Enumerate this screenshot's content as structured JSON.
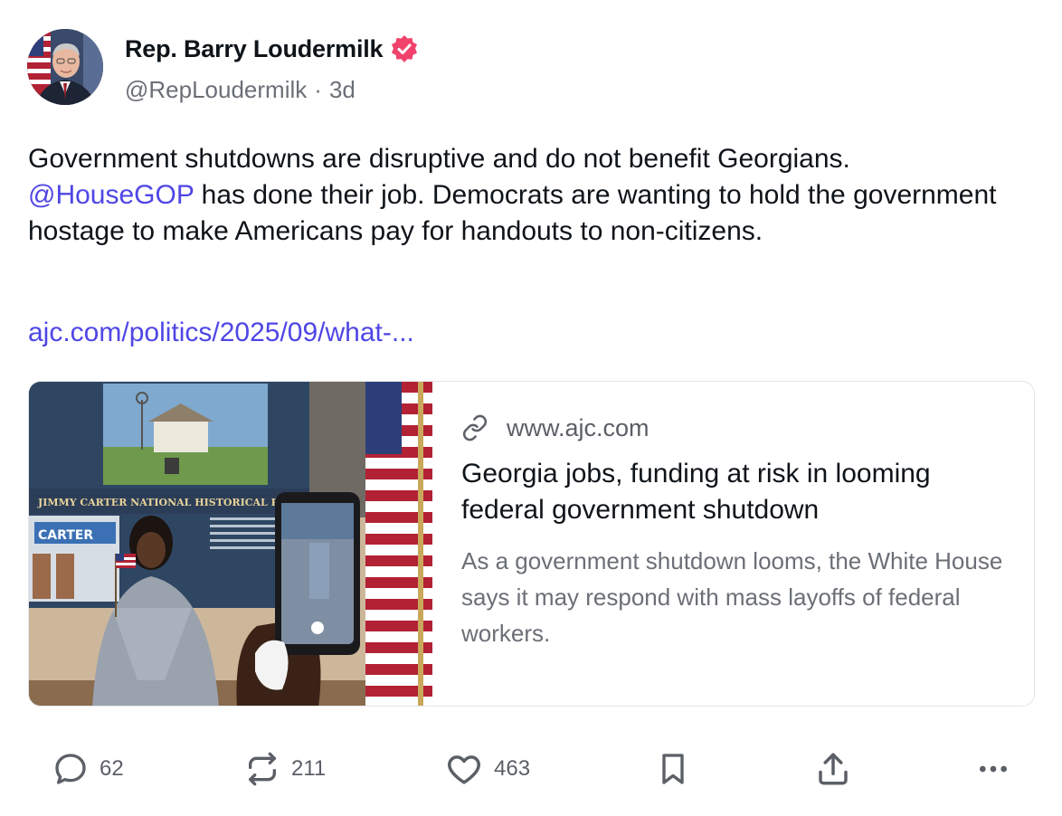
{
  "author": {
    "display_name": "Rep. Barry Loudermilk",
    "handle": "@RepLoudermilk",
    "separator": "·",
    "time_ago": "3d",
    "verified_icon": "verified-badge-icon",
    "verified_color": "#f0426b"
  },
  "post": {
    "text_part1": "Government shutdowns are disruptive and do not benefit Georgians. ",
    "mention": "@HouseGOP",
    "text_part2": " has done their job. Democrats are wanting to hold the government hostage to make Americans pay for handouts to non-citizens.",
    "link": "ajc.com/politics/2025/09/what-..."
  },
  "link_card": {
    "domain": "www.ajc.com",
    "title": "Georgia jobs, funding at risk in looming federal government shutdown",
    "description": "As a government shutdown looms, the White House says it may respond with mass layoffs of federal workers.",
    "image_sign_text": "JIMMY CARTER NATIONAL HISTORICAL PARK",
    "image_store_text": "CARTER"
  },
  "actions": {
    "reply_count": "62",
    "repost_count": "211",
    "like_count": "463"
  },
  "colors": {
    "accent_link": "#4f46e5",
    "text_primary": "#0f1419",
    "text_secondary": "#6b6f76",
    "card_border": "#e3e5e8"
  }
}
